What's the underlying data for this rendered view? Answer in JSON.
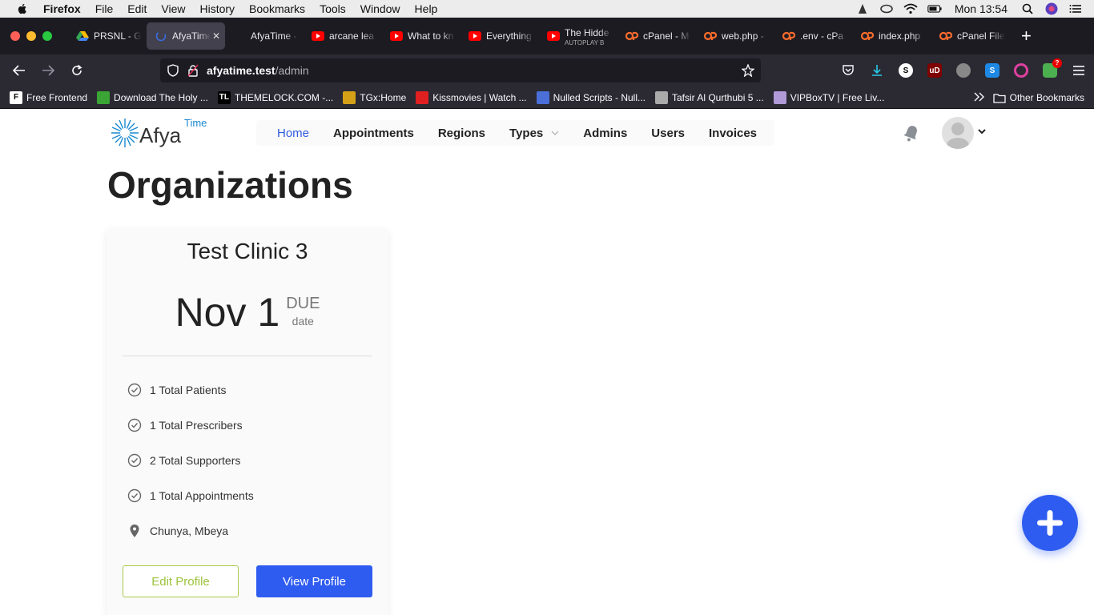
{
  "menubar": {
    "items": [
      "Firefox",
      "File",
      "Edit",
      "View",
      "History",
      "Bookmarks",
      "Tools",
      "Window",
      "Help"
    ],
    "clock": "Mon 13:54"
  },
  "tabs": [
    {
      "title": "PRSNL - G",
      "icon": "google-drive-icon",
      "active": false
    },
    {
      "title": "AfyaTime",
      "icon": "loading-icon",
      "active": true
    },
    {
      "title": "AfyaTime - Pat",
      "icon": "none",
      "active": false
    },
    {
      "title": "arcane lea",
      "icon": "youtube-icon",
      "active": false
    },
    {
      "title": "What to kn",
      "icon": "youtube-icon",
      "active": false
    },
    {
      "title": "Everything",
      "icon": "youtube-icon",
      "active": false
    },
    {
      "title": "The Hidde",
      "subtitle": "AUTOPLAY B",
      "icon": "youtube-icon",
      "active": false
    },
    {
      "title": "cPanel - M",
      "icon": "cpanel-icon",
      "active": false
    },
    {
      "title": "web.php -",
      "icon": "cpanel-icon",
      "active": false
    },
    {
      "title": ".env - cPa",
      "icon": "cpanel-icon",
      "active": false
    },
    {
      "title": "index.php",
      "icon": "cpanel-icon",
      "active": false
    },
    {
      "title": "cPanel File",
      "icon": "cpanel-icon",
      "active": false
    }
  ],
  "url": {
    "host": "afyatime.test",
    "path": "/admin"
  },
  "bookmarks": [
    {
      "label": "Free Frontend",
      "icon": "F",
      "color": "#ffffff"
    },
    {
      "label": "Download The Holy ...",
      "icon": "",
      "color": "#3aa535"
    },
    {
      "label": "THEMELOCK.COM -...",
      "icon": "TL",
      "color": "#000000"
    },
    {
      "label": "TGx:Home",
      "icon": "",
      "color": "#d4a017"
    },
    {
      "label": "Kissmovies | Watch ...",
      "icon": "",
      "color": "#e02020"
    },
    {
      "label": "Nulled Scripts - Null...",
      "icon": "",
      "color": "#4a6fd8"
    },
    {
      "label": "Tafsir Al Qurthubi 5 ...",
      "icon": "",
      "color": "#aaaaaa"
    },
    {
      "label": "VIPBoxTV | Free Liv...",
      "icon": "",
      "color": "#b09ad8"
    }
  ],
  "bookmarks_other": "Other Bookmarks",
  "app": {
    "logo_word": "Afya",
    "logo_time": "Time",
    "nav": [
      {
        "label": "Home",
        "active": true
      },
      {
        "label": "Appointments",
        "active": false
      },
      {
        "label": "Regions",
        "active": false
      },
      {
        "label": "Types",
        "active": false,
        "dropdown": true
      },
      {
        "label": "Admins",
        "active": false
      },
      {
        "label": "Users",
        "active": false
      },
      {
        "label": "Invoices",
        "active": false
      }
    ],
    "page_title": "Organizations",
    "card": {
      "name": "Test Clinic 3",
      "due_date": "Nov 1",
      "due_label": "DUE",
      "date_label": "date",
      "stats": [
        {
          "text": "1 Total Patients",
          "icon": "check-circle-icon"
        },
        {
          "text": "1 Total Prescribers",
          "icon": "check-circle-icon"
        },
        {
          "text": "2 Total Supporters",
          "icon": "check-circle-icon"
        },
        {
          "text": "1 Total Appointments",
          "icon": "check-circle-icon"
        },
        {
          "text": "Chunya, Mbeya",
          "icon": "map-pin-icon"
        }
      ],
      "edit_label": "Edit Profile",
      "view_label": "View Profile"
    }
  },
  "colors": {
    "primary": "#2f5cf0",
    "accent_green": "#9cc33b",
    "logo_blue": "#1b8ad0"
  }
}
